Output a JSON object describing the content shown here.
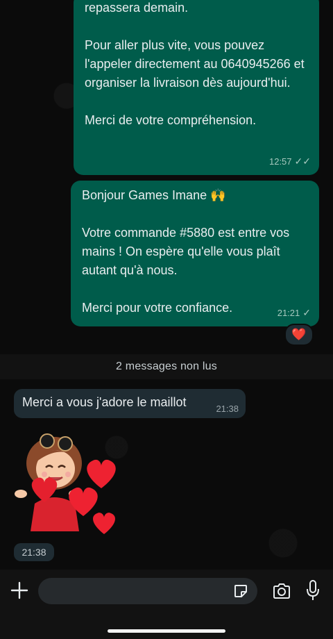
{
  "messages": {
    "msg1": {
      "text": "repassera demain.\n\nPour aller plus vite, vous pouvez l'appeler directement au 0640945266 et organiser la livraison dès aujourd'hui.\n\nMerci de votre compréhension.",
      "time": "12:57",
      "status_icon": "double-check-icon"
    },
    "msg2": {
      "text": "Bonjour Games Imane 🙌\n\nVotre commande #5880 est entre vos mains ! On espère qu'elle vous plaît autant qu'à nous.\n\nMerci pour votre confiance.",
      "time": "21:21",
      "status_icon": "single-check-icon",
      "reaction": "❤️"
    },
    "unread_label": "2 messages non lus",
    "msg3": {
      "text": "Merci a vous j'adore le maillot",
      "time": "21:38"
    },
    "sticker": {
      "icon": "girl-with-hearts-sticker",
      "time": "21:38"
    }
  },
  "composer": {
    "placeholder": "",
    "icons": [
      "plus-icon",
      "sticker-icon",
      "camera-icon",
      "microphone-icon"
    ]
  },
  "colors": {
    "outgoing_bubble": "#005c4b",
    "incoming_bubble": "#1f2c33",
    "background": "#0b0b0b"
  }
}
